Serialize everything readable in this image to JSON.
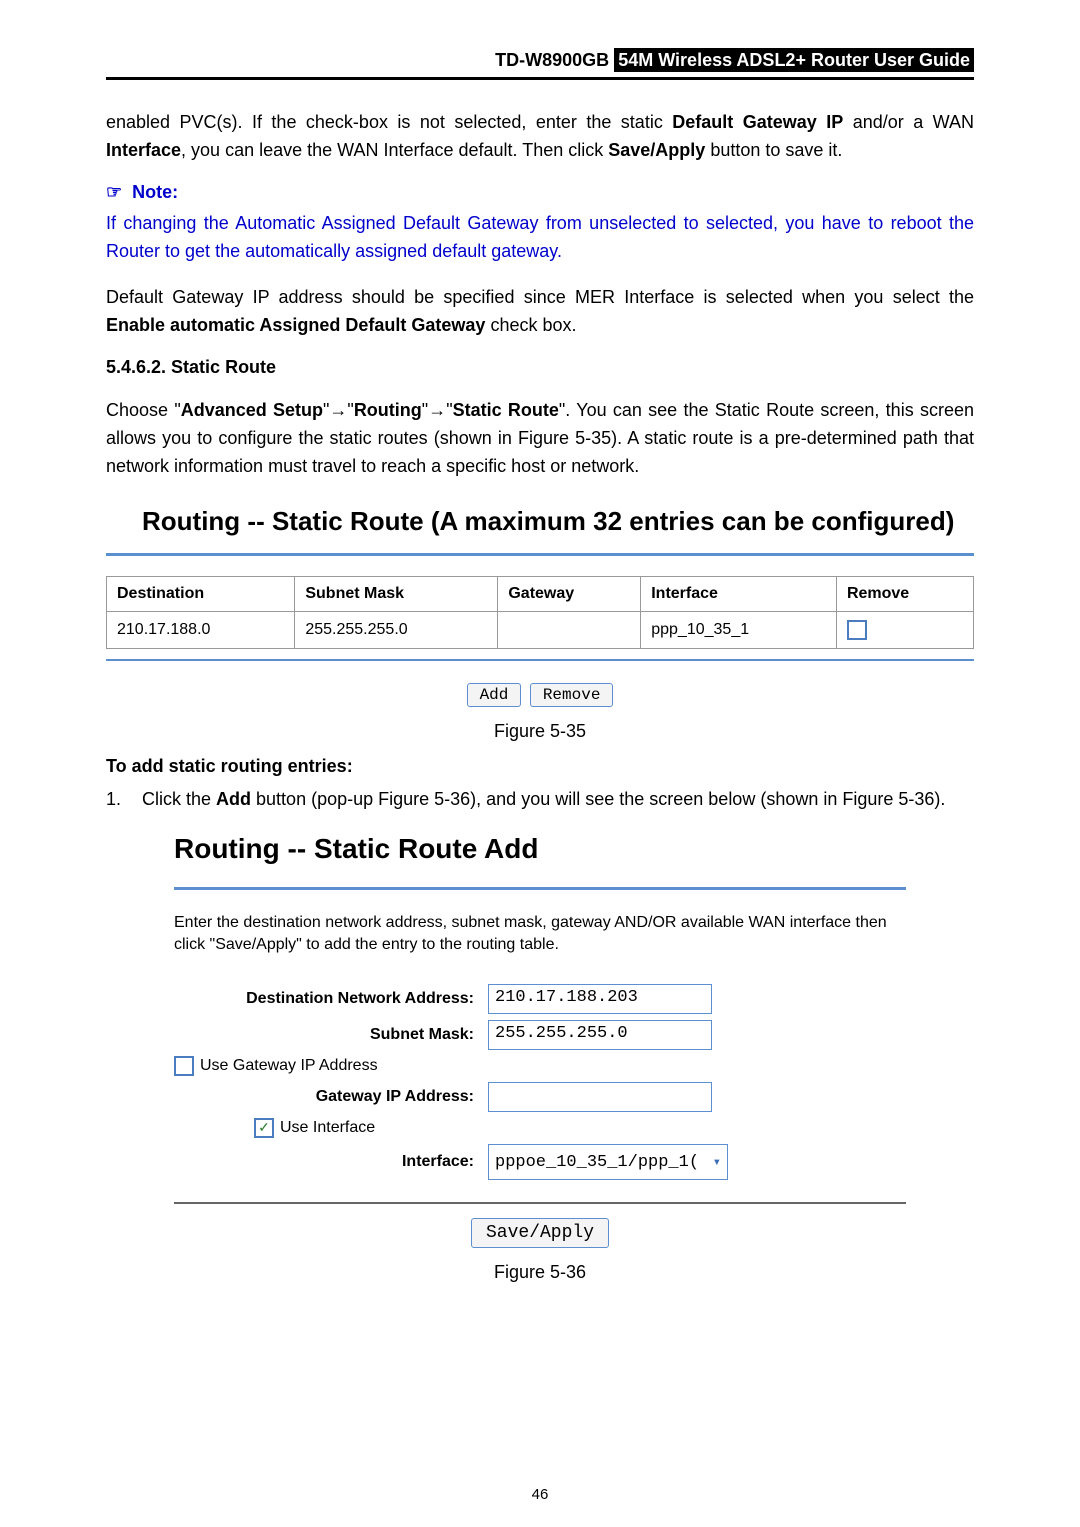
{
  "header": {
    "model": "TD-W8900GB",
    "title_rev": "54M  Wireless  ADSL2+  Router  User  Guide"
  },
  "para1_pre": "enabled PVC(s). If the check-box is not selected, enter the static ",
  "para1_b1": "Default Gateway IP",
  "para1_mid1": " and/or a WAN ",
  "para1_b2": "Interface",
  "para1_mid2": ", you can leave the WAN Interface default. Then click ",
  "para1_b3": "Save/Apply",
  "para1_end": " button to save it.",
  "note_icon": "☞",
  "note_label": "Note:",
  "note_body": "If changing the Automatic Assigned Default Gateway from unselected to selected, you have to reboot the Router to get the automatically assigned default gateway.",
  "para2_pre": "Default Gateway IP address should be specified since MER Interface is selected when you select the ",
  "para2_b1": "Enable automatic Assigned Default Gateway",
  "para2_end": " check box.",
  "sec_num": "5.4.6.2.  Static Route",
  "para3_pre": "Choose \"",
  "para3_b1": "Advanced Setup",
  "para3_mid1": "\"",
  "arrow": "→",
  "para3_mid2": "\"",
  "para3_b2": "Routing",
  "para3_mid3": "\"",
  "para3_mid4": "\"",
  "para3_b3": "Static Route",
  "para3_end": "\". You can see the Static Route screen, this screen allows you to configure the static routes (shown in Figure 5-35). A static route is a pre-determined path that network information must travel to reach a specific host or network.",
  "fig35": {
    "title": "Routing -- Static Route (A maximum 32 entries can be configured)",
    "cols": [
      "Destination",
      "Subnet Mask",
      "Gateway",
      "Interface",
      "Remove"
    ],
    "row": {
      "dest": "210.17.188.0",
      "mask": "255.255.255.0",
      "gw": "",
      "iface": "ppp_10_35_1"
    },
    "btn_add": "Add",
    "btn_remove": "Remove",
    "caption": "Figure 5-35"
  },
  "subhead": "To add static routing entries:",
  "li1_num": "1.",
  "li1_pre": "Click the ",
  "li1_b1": "Add",
  "li1_end": " button (pop-up Figure 5-36), and you will see the screen below (shown in Figure 5-36).",
  "fig36": {
    "title": "Routing -- Static Route Add",
    "desc": "Enter the destination network address, subnet mask, gateway AND/OR available WAN interface then click \"Save/Apply\" to add the entry to the routing table.",
    "lbl_dest": "Destination Network Address:",
    "val_dest": "210.17.188.203",
    "lbl_mask": "Subnet Mask:",
    "val_mask": "255.255.255.0",
    "lbl_usegw": "Use Gateway IP Address",
    "lbl_gwip": "Gateway IP Address:",
    "val_gwip": "",
    "lbl_useif": "Use Interface",
    "lbl_iface": "Interface:",
    "val_iface": "pppoe_10_35_1/ppp_1(",
    "btn_save": "Save/Apply",
    "caption": "Figure 5-36"
  },
  "page_num": "46"
}
